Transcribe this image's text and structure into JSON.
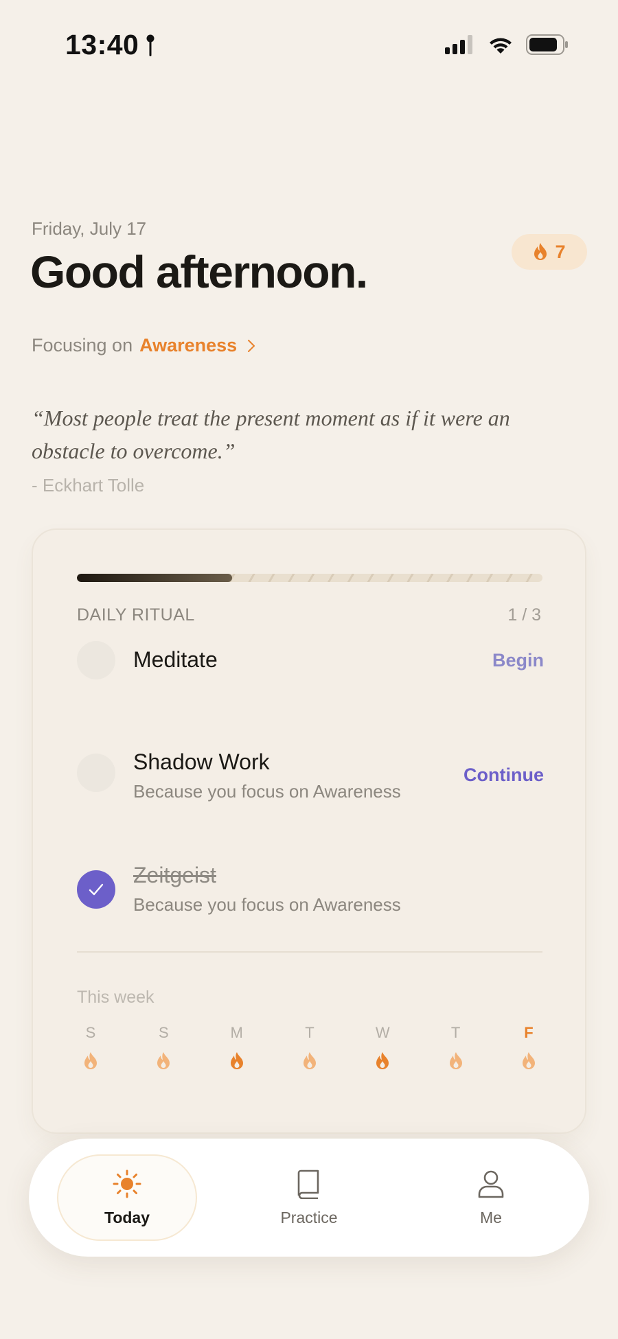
{
  "status_bar": {
    "time": "13:40"
  },
  "header": {
    "date": "Friday, July 17",
    "greeting": "Good afternoon.",
    "streak_count": "7",
    "focus_prefix": "Focusing on",
    "focus_value": "Awareness"
  },
  "quote": {
    "text": "“Most people treat the present moment as if it were an obstacle to overcome.”",
    "author": "- Eckhart Tolle"
  },
  "ritual": {
    "title": "DAILY RITUAL",
    "count": "1 / 3",
    "progress": 0.333,
    "tasks": [
      {
        "name": "Meditate",
        "subtitle": "",
        "action": "Begin",
        "done": false
      },
      {
        "name": "Shadow Work",
        "subtitle": "Because you focus on Awareness",
        "action": "Continue",
        "done": false
      },
      {
        "name": "Zeitgeist",
        "subtitle": "Because you focus on Awareness",
        "action": "",
        "done": true
      }
    ],
    "week_title": "This week",
    "week": [
      {
        "letter": "S",
        "level": "light"
      },
      {
        "letter": "S",
        "level": "light"
      },
      {
        "letter": "M",
        "level": "full"
      },
      {
        "letter": "T",
        "level": "light"
      },
      {
        "letter": "W",
        "level": "full"
      },
      {
        "letter": "T",
        "level": "light"
      },
      {
        "letter": "F",
        "level": "light",
        "today": true
      }
    ]
  },
  "nav": {
    "items": [
      {
        "label": "Today",
        "icon": "sun-icon",
        "active": true
      },
      {
        "label": "Practice",
        "icon": "book-icon",
        "active": false
      },
      {
        "label": "Me",
        "icon": "person-icon",
        "active": false
      }
    ]
  },
  "colors": {
    "accent": "#e8822c",
    "primary": "#6c5fc9",
    "background": "#f5f0e9"
  }
}
